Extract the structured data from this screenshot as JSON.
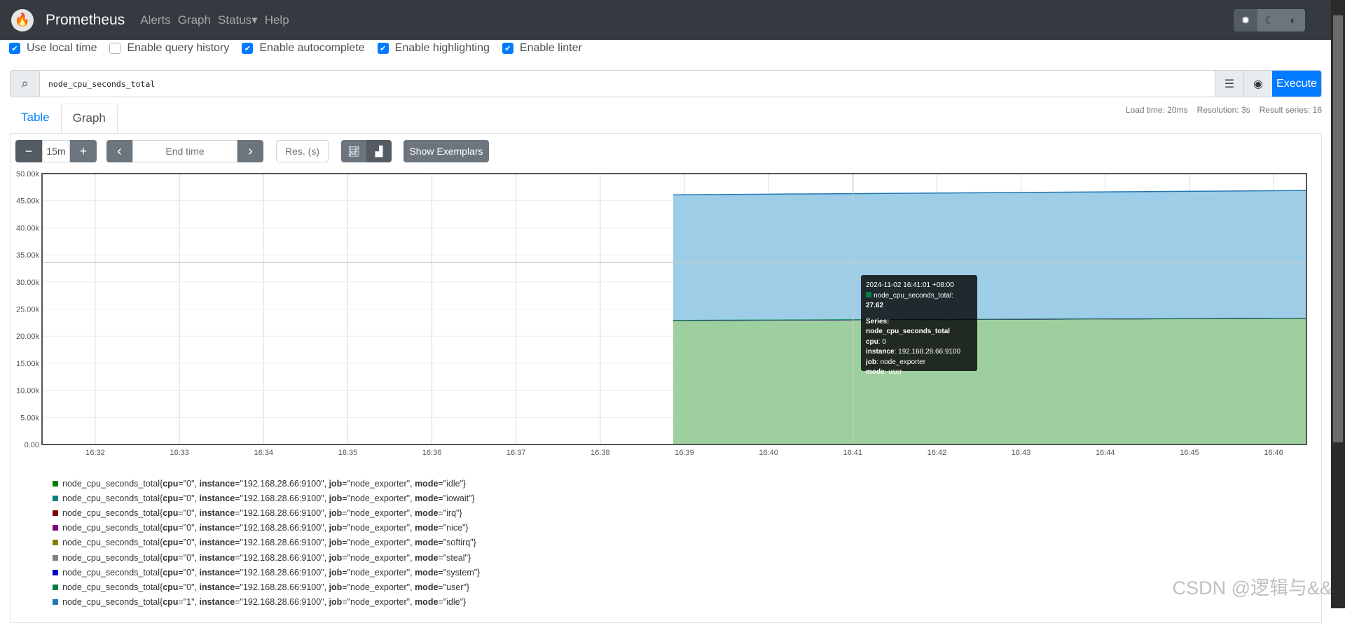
{
  "nav": {
    "brand": "Prometheus",
    "links": [
      "Alerts",
      "Graph",
      "Status",
      "Help"
    ],
    "status_caret": "▾",
    "theme_icons": [
      "sun-gear-icon",
      "moon-icon",
      "contrast-icon"
    ]
  },
  "settings": [
    {
      "label": "Use local time",
      "checked": true
    },
    {
      "label": "Enable query history",
      "checked": false
    },
    {
      "label": "Enable autocomplete",
      "checked": true
    },
    {
      "label": "Enable highlighting",
      "checked": true
    },
    {
      "label": "Enable linter",
      "checked": true
    }
  ],
  "query": {
    "value": "node_cpu_seconds_total",
    "execute": "Execute"
  },
  "tabs": {
    "table": "Table",
    "graph": "Graph"
  },
  "stats": {
    "load": "Load time: 20ms",
    "resolution": "Resolution: 3s",
    "series": "Result series: 16"
  },
  "controls": {
    "minus": "−",
    "range": "15m",
    "plus": "+",
    "prev": "‹",
    "end_time": "End time",
    "next": "›",
    "res": "Res. (s)",
    "exemplars": "Show Exemplars"
  },
  "tooltip": {
    "time": "2024-11-02 16:41:01 +08:00",
    "metric": "node_cpu_seconds_total:",
    "value": "27.62",
    "series_label": "Series:",
    "name": "node_cpu_seconds_total",
    "labels": [
      [
        "cpu",
        "0"
      ],
      [
        "instance",
        "192.168.28.66:9100"
      ],
      [
        "job",
        "node_exporter"
      ],
      [
        "mode",
        "user"
      ]
    ],
    "color": "#008040"
  },
  "chart_data": {
    "type": "area",
    "stacked": true,
    "ylim": [
      0,
      50000
    ],
    "yticks": [
      "0.00",
      "5.00k",
      "10.00k",
      "15.00k",
      "20.00k",
      "25.00k",
      "30.00k",
      "35.00k",
      "40.00k",
      "45.00k",
      "50.00k"
    ],
    "xticks": [
      "16:32",
      "16:33",
      "16:34",
      "16:35",
      "16:36",
      "16:37",
      "16:38",
      "16:39",
      "16:40",
      "16:41",
      "16:42",
      "16:43",
      "16:44",
      "16:45",
      "16:46"
    ],
    "x_start": "16:38:52",
    "x_end": "16:46:23",
    "series": [
      {
        "mode": "idle",
        "cpu": "0",
        "color": "#008000",
        "fill": "#99cc99",
        "values": [
          22900,
          23300
        ]
      },
      {
        "mode": "iowait",
        "cpu": "0",
        "color": "#008080",
        "values": [
          10,
          10
        ]
      },
      {
        "mode": "irq",
        "cpu": "0",
        "color": "#800000",
        "values": [
          0,
          0
        ]
      },
      {
        "mode": "nice",
        "cpu": "0",
        "color": "#800080",
        "values": [
          1,
          1
        ]
      },
      {
        "mode": "softirq",
        "cpu": "0",
        "color": "#808000",
        "values": [
          5,
          5
        ]
      },
      {
        "mode": "steal",
        "cpu": "0",
        "color": "#808080",
        "values": [
          0,
          0
        ]
      },
      {
        "mode": "system",
        "cpu": "0",
        "color": "#0000cc",
        "values": [
          40,
          40
        ]
      },
      {
        "mode": "user",
        "cpu": "0",
        "color": "#008040",
        "values": [
          27,
          28
        ]
      },
      {
        "mode": "idle",
        "cpu": "1",
        "color": "#1f77b4",
        "fill": "#99cbe6",
        "values": [
          23100,
          23500
        ]
      }
    ]
  },
  "legend": {
    "metric": "node_cpu_seconds_total",
    "instance": "192.168.28.66:9100",
    "job": "node_exporter"
  },
  "watermark": "CSDN @逻辑与&&"
}
